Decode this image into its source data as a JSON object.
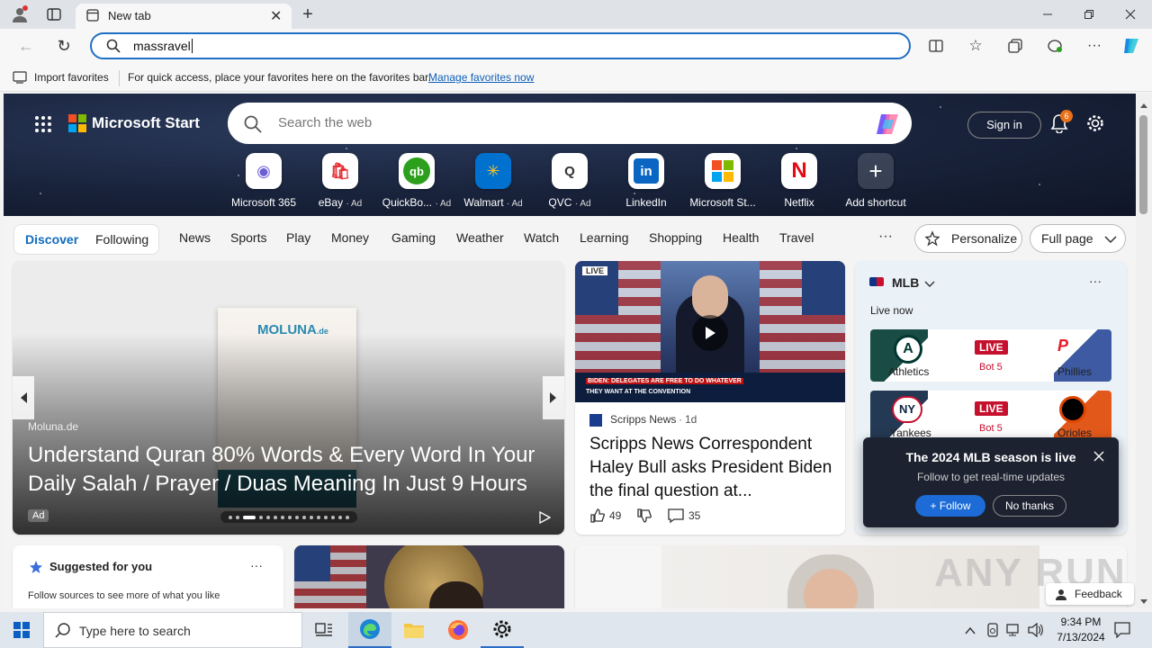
{
  "browser": {
    "tab_title": "New tab",
    "address_value": "massravel",
    "favbar": {
      "import_label": "Import favorites",
      "hint_text": "For quick access, place your favorites here on the favorites bar.",
      "manage_link": "Manage favorites now"
    }
  },
  "start": {
    "brand": "Microsoft Start",
    "search_placeholder": "Search the web",
    "sign_in": "Sign in",
    "notification_count": "6",
    "shortcuts": [
      {
        "label": "Microsoft 365",
        "ad": "",
        "glyph": "◉",
        "color": "#6b5fd6"
      },
      {
        "label": "eBay",
        "ad": "· Ad",
        "glyph": "🛍",
        "color": "#e53238"
      },
      {
        "label": "QuickBo...",
        "ad": "· Ad",
        "glyph": "qb",
        "color": "#2ca01c"
      },
      {
        "label": "Walmart",
        "ad": "· Ad",
        "glyph": "✳",
        "color": "#ffc220"
      },
      {
        "label": "QVC",
        "ad": "· Ad",
        "glyph": "Q",
        "color": "#333"
      },
      {
        "label": "LinkedIn",
        "ad": "",
        "glyph": "in",
        "color": "#0a66c2"
      },
      {
        "label": "Microsoft St...",
        "ad": "",
        "glyph": "▦",
        "color": "#f25022"
      },
      {
        "label": "Netflix",
        "ad": "",
        "glyph": "N",
        "color": "#e50914"
      },
      {
        "label": "Add shortcut",
        "ad": "",
        "glyph": "+",
        "color": "#444"
      }
    ],
    "tabs": {
      "discover": "Discover",
      "following": "Following",
      "items": [
        "News",
        "Sports",
        "Play",
        "Money",
        "Gaming",
        "Weather",
        "Watch",
        "Learning",
        "Shopping",
        "Health",
        "Travel"
      ],
      "more": "···",
      "personalize": "Personalize",
      "full_page": "Full page"
    }
  },
  "main_card": {
    "product_brand": "MOLUNA",
    "product_brand_suffix": ".de",
    "source": "Moluna.de",
    "headline": "Understand Quran 80% Words & Every Word In Your Daily Salah / Prayer / Duas Meaning In Just 9 Hours",
    "ad_badge": "Ad"
  },
  "news_card": {
    "badge": "LIVE",
    "ticker_line1": "BIDEN: DELEGATES ARE FREE TO DO WHATEVER",
    "ticker_line2": "THEY WANT AT THE CONVENTION",
    "source": "Scripps News",
    "age": "1d",
    "title": "Scripps News Correspondent Haley Bull asks President Biden the final question at...",
    "likes": "49",
    "comments": "35"
  },
  "mlb": {
    "title": "MLB",
    "live_now": "Live now",
    "games": [
      {
        "team_left": "Athletics",
        "team_right": "Phillies",
        "status": "LIVE",
        "inning": "Bot 5",
        "left_color": "#003831",
        "right_color": "#284898"
      },
      {
        "team_left": "Yankees",
        "team_right": "Orioles",
        "status": "LIVE",
        "inning": "Bot 5",
        "left_color": "#0c2340",
        "right_color": "#df4601"
      }
    ],
    "popup_title": "The 2024 MLB season is live",
    "popup_sub": "Follow to get real-time updates",
    "follow": "Follow",
    "no_thanks": "No thanks"
  },
  "suggested": {
    "title": "Suggested for you",
    "sub": "Follow sources to see more of what you like"
  },
  "feedback": "Feedback",
  "watermark": "ANY RUN",
  "taskbar": {
    "search_placeholder": "Type here to search",
    "time": "9:34 PM",
    "date": "7/13/2024"
  }
}
